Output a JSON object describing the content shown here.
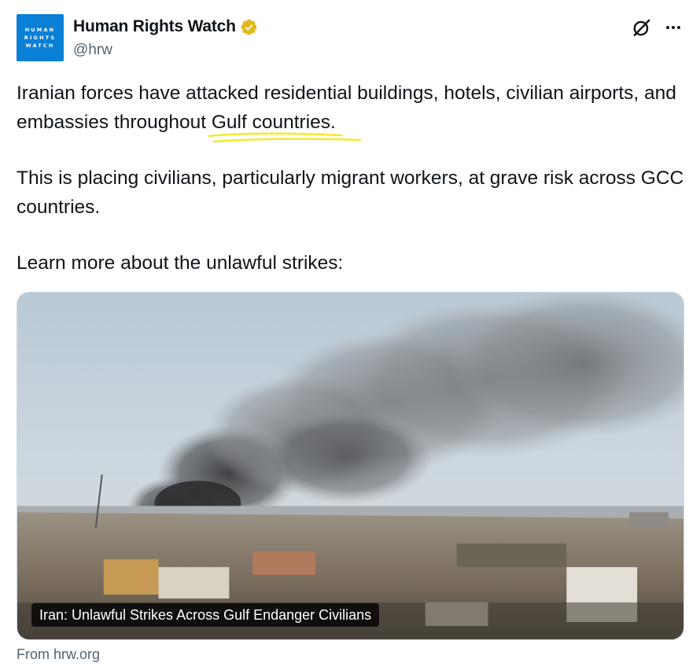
{
  "author": {
    "avatar_lines": [
      "HUMAN",
      "RIGHTS",
      "WATCH"
    ],
    "display_name": "Human Rights Watch",
    "handle": "@hrw",
    "verified_badge": "gold-verified-badge-icon"
  },
  "actions": {
    "grok_icon": "grok-icon",
    "more_icon": "more-options-icon"
  },
  "tweet": {
    "paragraph_1_before": "Iranian forces have attacked residential buildings, hotels, civilian airports, and embassies throughout ",
    "paragraph_1_highlight": "Gulf countries.",
    "highlight_color": "#f5e92a",
    "paragraph_2": "This is placing civilians, particularly migrant workers, at grave risk across GCC countries.",
    "paragraph_3": "Learn more about the unlawful strikes:"
  },
  "link_card": {
    "caption": "Iran: Unlawful Strikes Across Gulf Endanger Civilians",
    "source": "From hrw.org"
  },
  "colors": {
    "text": "#0f1419",
    "secondary_text": "#536471",
    "avatar_blue": "#0a7fd6",
    "verified_gold": "#e2b719"
  }
}
